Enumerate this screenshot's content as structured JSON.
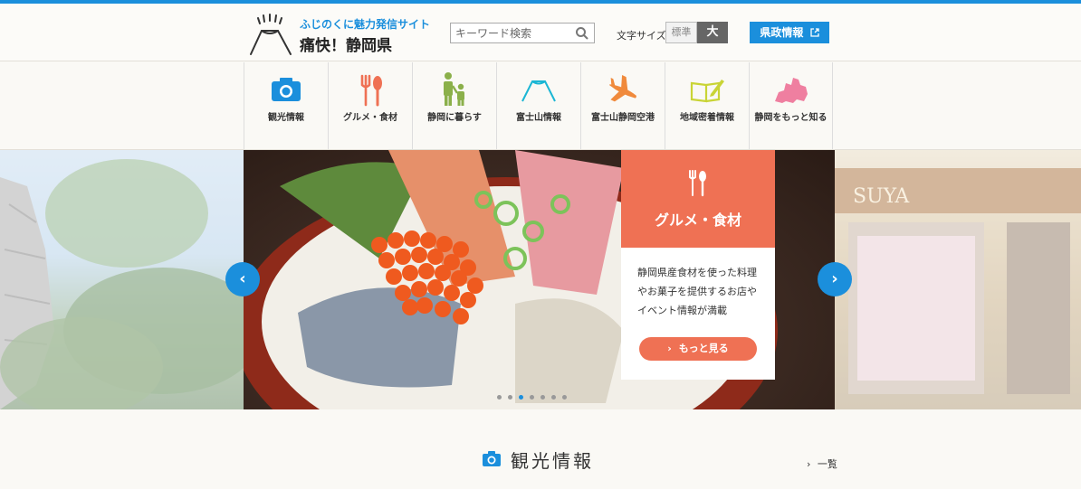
{
  "header": {
    "logo_sub": "ふじのくに魅力発信サイト",
    "logo_main": "痛快！静岡県",
    "search_placeholder": "キーワード検索",
    "font_size_label": "文字サイズ",
    "font_std": "標準",
    "font_large": "大",
    "pref_info": "県政情報"
  },
  "nav": {
    "items": [
      {
        "label": "観光情報",
        "icon": "camera-icon",
        "color": "#1b8fdc"
      },
      {
        "label": "グルメ・食材",
        "icon": "fork-knife-icon",
        "color": "#ef7154"
      },
      {
        "label": "静岡に暮らす",
        "icon": "family-icon",
        "color": "#8bb04a"
      },
      {
        "label": "富士山情報",
        "icon": "mount-fuji-icon",
        "color": "#1bb6d4"
      },
      {
        "label": "富士山静岡空港",
        "icon": "airplane-icon",
        "color": "#f08a3c"
      },
      {
        "label": "地域密着情報",
        "icon": "book-pencil-icon",
        "color": "#c9d435"
      },
      {
        "label": "静岡をもっと知る",
        "icon": "shizuoka-map-icon",
        "color": "#ef7fa0"
      }
    ]
  },
  "slide": {
    "title": "グルメ・食材",
    "text": "静岡県産食材を使った料理やお菓子を提供するお店やイベント情報が満載",
    "button": "もっと見る",
    "active_index": 2,
    "count": 7
  },
  "section": {
    "title": "観光情報",
    "list_link": "一覧"
  }
}
